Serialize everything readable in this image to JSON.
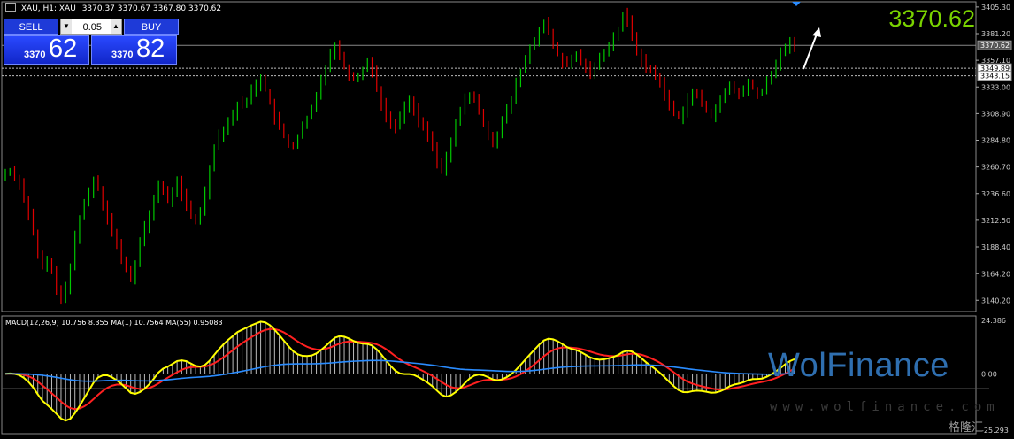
{
  "header": {
    "title": "XAU, H1: XAU",
    "ohlc": "3370.37 3370.67 3367.80 3370.62"
  },
  "trade_panel": {
    "sell_label": "SELL",
    "buy_label": "BUY",
    "lot_value": "0.05",
    "sell_prefix": "3370",
    "sell_big": "62",
    "buy_prefix": "3370",
    "buy_big": "82"
  },
  "big_price": "3370.62",
  "macd_label": "MACD(12,26,9) 10.756 8.355 MA(1) 10.7564 MA(55) 0.95083",
  "watermark": "WolFinance",
  "watermark_sub": "www.wolfinance.com",
  "corner_logo": "格隆汇",
  "colors": {
    "bull": "#00c800",
    "bear": "#e00000",
    "macd_fast": "#ffff00",
    "macd_slow": "#ff2020",
    "ma_long": "#2a8cff",
    "price_text": "#7ad300"
  },
  "chart_data": [
    {
      "type": "candlestick",
      "symbol": "XAU",
      "timeframe": "H1",
      "ylim": [
        3130,
        3410
      ],
      "y_ticks": [
        "3405.30",
        "3381.20",
        "3357.10",
        "3333.00",
        "3308.90",
        "3284.80",
        "3260.70",
        "3236.60",
        "3212.50",
        "3188.40",
        "3164.20",
        "3140.20"
      ],
      "current_price": 3370.62,
      "price_tags": [
        "3370.62",
        "3349.89",
        "3343.15"
      ],
      "reference_lines": [
        3370.62,
        3349.89,
        3343.15
      ],
      "closes": [
        3255,
        3258,
        3252,
        3246,
        3232,
        3218,
        3200,
        3180,
        3170,
        3176,
        3165,
        3152,
        3140,
        3150,
        3170,
        3198,
        3215,
        3228,
        3238,
        3250,
        3242,
        3228,
        3215,
        3200,
        3190,
        3178,
        3168,
        3158,
        3175,
        3192,
        3205,
        3218,
        3232,
        3245,
        3238,
        3230,
        3240,
        3246,
        3236,
        3226,
        3215,
        3212,
        3222,
        3238,
        3260,
        3280,
        3290,
        3296,
        3302,
        3308,
        3318,
        3316,
        3322,
        3330,
        3335,
        3342,
        3330,
        3318,
        3305,
        3296,
        3288,
        3282,
        3280,
        3288,
        3296,
        3305,
        3312,
        3325,
        3340,
        3352,
        3364,
        3370,
        3362,
        3352,
        3345,
        3340,
        3344,
        3350,
        3356,
        3348,
        3332,
        3318,
        3305,
        3300,
        3298,
        3305,
        3316,
        3320,
        3314,
        3302,
        3295,
        3288,
        3278,
        3265,
        3258,
        3268,
        3286,
        3300,
        3310,
        3322,
        3326,
        3320,
        3312,
        3300,
        3290,
        3284,
        3290,
        3302,
        3312,
        3322,
        3335,
        3348,
        3358,
        3368,
        3375,
        3386,
        3390,
        3382,
        3370,
        3362,
        3355,
        3352,
        3358,
        3362,
        3356,
        3350,
        3347,
        3352,
        3358,
        3366,
        3372,
        3378,
        3385,
        3398,
        3392,
        3380,
        3366,
        3356,
        3350,
        3348,
        3344,
        3336,
        3326,
        3316,
        3310,
        3306,
        3312,
        3322,
        3328,
        3324,
        3318,
        3312,
        3308,
        3314,
        3320,
        3328,
        3334,
        3330,
        3326,
        3330,
        3336,
        3332,
        3326,
        3328,
        3338,
        3346,
        3354,
        3362,
        3370,
        3372,
        3370
      ]
    },
    {
      "type": "line",
      "title": "MACD(12,26,9)",
      "y_ticks": [
        "24.386",
        "0.00",
        "-25.293"
      ],
      "ylim": [
        -25.293,
        24.386
      ],
      "values": {
        "macd": 10.756,
        "signal": 8.355,
        "ma1": 10.7564,
        "ma55": 0.95083
      }
    }
  ]
}
